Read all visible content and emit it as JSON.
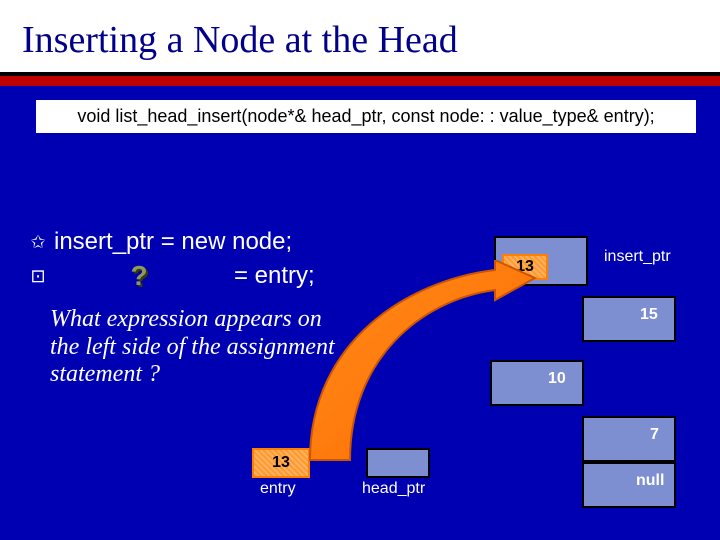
{
  "title": "Inserting a Node at the Head",
  "signature": "void list_head_insert(node*& head_ptr, const node: : value_type& entry);",
  "code": {
    "line1": "insert_ptr = new node;",
    "line2_blank_marker": "?",
    "line2_rest": "= entry;"
  },
  "question": "What expression appears on the left side of the assignment statement ?",
  "entry": {
    "value": "13",
    "label": "entry"
  },
  "head_ptr": {
    "label": "head_ptr"
  },
  "insert_ptr": {
    "label": "insert_ptr",
    "value": "13"
  },
  "list": {
    "nodes": [
      {
        "value": "15"
      },
      {
        "value": "10"
      },
      {
        "value": "7"
      },
      {
        "value": "null"
      }
    ]
  }
}
